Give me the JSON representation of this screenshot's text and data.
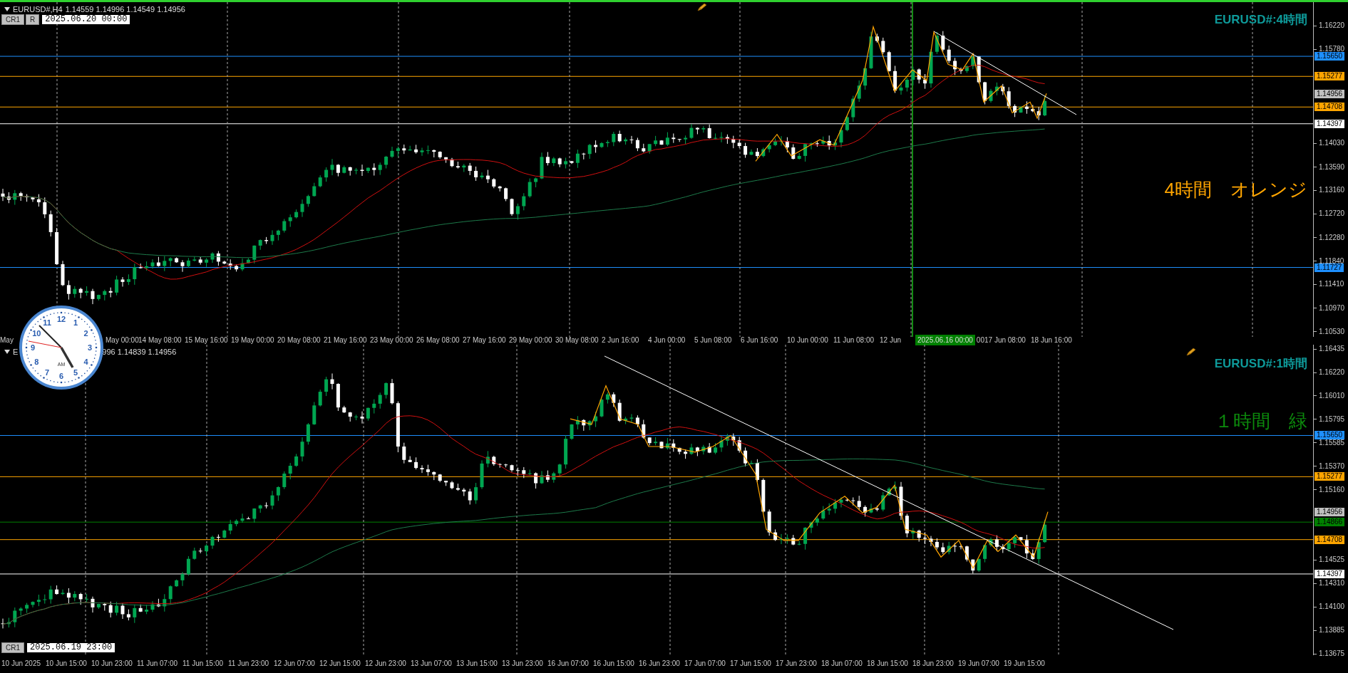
{
  "upper_chart": {
    "header": {
      "symbol": "EURUSD#,H4",
      "quote": "1.14559 1.14996 1.14549 1.14956"
    },
    "buttons": [
      "CR1",
      "R"
    ],
    "cursor_time": "2025.06.20 00:00",
    "title": "EURUSD#:4時間",
    "note": "4時間　オレンジ",
    "price_ticks": [
      "1.16220",
      "1.15780",
      "1.14030",
      "1.13590",
      "1.13160",
      "1.12720",
      "1.12280",
      "1.11840",
      "1.11410",
      "1.10970",
      "1.10530"
    ],
    "price_labels": [
      {
        "text": "1.15650",
        "kind": "level",
        "color": "#1e90ff"
      },
      {
        "text": "1.15277",
        "kind": "level",
        "color": "#ffa500"
      },
      {
        "text": "1.14956",
        "kind": "bid",
        "color": "#c0c0c0"
      },
      {
        "text": "1.14708",
        "kind": "level",
        "color": "#ffa500"
      },
      {
        "text": "1.14397",
        "kind": "level",
        "color": "#ffffff"
      },
      {
        "text": "1.11727",
        "kind": "level",
        "color": "#1e90ff"
      }
    ],
    "time_ticks": [
      {
        "text": "May",
        "kind": "tick"
      },
      {
        "text": "May 00:00",
        "kind": "tick"
      },
      {
        "text": "14 May 08:00",
        "kind": "tick"
      },
      {
        "text": "15 May 16:00",
        "kind": "tick"
      },
      {
        "text": "19 May 00:00",
        "kind": "tick"
      },
      {
        "text": "20 May 08:00",
        "kind": "tick"
      },
      {
        "text": "21 May 16:00",
        "kind": "tick"
      },
      {
        "text": "23 May 00:00",
        "kind": "tick"
      },
      {
        "text": "26 May 08:00",
        "kind": "tick"
      },
      {
        "text": "27 May 16:00",
        "kind": "tick"
      },
      {
        "text": "29 May 00:00",
        "kind": "tick"
      },
      {
        "text": "30 May 08:00",
        "kind": "tick"
      },
      {
        "text": "2 Jun 16:00",
        "kind": "tick"
      },
      {
        "text": "4 Jun 00:00",
        "kind": "tick"
      },
      {
        "text": "5 Jun 08:00",
        "kind": "tick"
      },
      {
        "text": "6 Jun 16:00",
        "kind": "tick"
      },
      {
        "text": "10 Jun 00:00",
        "kind": "tick"
      },
      {
        "text": "11 Jun 08:00",
        "kind": "tick"
      },
      {
        "text": "12 Jun",
        "kind": "tick"
      },
      {
        "text": "2025.06.16 00:00",
        "kind": "marker"
      },
      {
        "text": "00",
        "kind": "tick"
      },
      {
        "text": "17 Jun 08:00",
        "kind": "tick"
      },
      {
        "text": "18 Jun 16:00",
        "kind": "tick"
      }
    ]
  },
  "lower_chart": {
    "header": {
      "symbol": "E",
      "quote": "996 1.14839 1.14956"
    },
    "buttons": [
      "CR1"
    ],
    "cursor_time": "2025.06.19 23:00",
    "title": "EURUSD#:1時間",
    "note": "１時間　緑",
    "price_ticks": [
      "1.16435",
      "1.16220",
      "1.16010",
      "1.15795",
      "1.15585",
      "1.15370",
      "1.15160",
      "1.14525",
      "1.14310",
      "1.14100",
      "1.13885",
      "1.13675"
    ],
    "price_labels": [
      {
        "text": "1.15650",
        "kind": "level",
        "color": "#1e90ff"
      },
      {
        "text": "1.15277",
        "kind": "level",
        "color": "#ffa500"
      },
      {
        "text": "1.14956",
        "kind": "bid",
        "color": "#c0c0c0"
      },
      {
        "text": "1.14866",
        "kind": "level",
        "color": "#008000"
      },
      {
        "text": "1.14708",
        "kind": "level",
        "color": "#ffa500"
      },
      {
        "text": "1.14397",
        "kind": "level",
        "color": "#ffffff"
      }
    ],
    "time_ticks": [
      {
        "text": "10 Jun 2025",
        "kind": "tick"
      },
      {
        "text": "10 Jun 15:00",
        "kind": "tick"
      },
      {
        "text": "10 Jun 23:00",
        "kind": "tick"
      },
      {
        "text": "11 Jun 07:00",
        "kind": "tick"
      },
      {
        "text": "11 Jun 15:00",
        "kind": "tick"
      },
      {
        "text": "11 Jun 23:00",
        "kind": "tick"
      },
      {
        "text": "12 Jun 07:00",
        "kind": "tick"
      },
      {
        "text": "12 Jun 15:00",
        "kind": "tick"
      },
      {
        "text": "12 Jun 23:00",
        "kind": "tick"
      },
      {
        "text": "13 Jun 07:00",
        "kind": "tick"
      },
      {
        "text": "13 Jun 15:00",
        "kind": "tick"
      },
      {
        "text": "13 Jun 23:00",
        "kind": "tick"
      },
      {
        "text": "16 Jun 07:00",
        "kind": "tick"
      },
      {
        "text": "16 Jun 15:00",
        "kind": "tick"
      },
      {
        "text": "16 Jun 23:00",
        "kind": "tick"
      },
      {
        "text": "17 Jun 07:00",
        "kind": "tick"
      },
      {
        "text": "17 Jun 15:00",
        "kind": "tick"
      },
      {
        "text": "17 Jun 23:00",
        "kind": "tick"
      },
      {
        "text": "18 Jun 07:00",
        "kind": "tick"
      },
      {
        "text": "18 Jun 15:00",
        "kind": "tick"
      },
      {
        "text": "18 Jun 23:00",
        "kind": "tick"
      },
      {
        "text": "19 Jun 07:00",
        "kind": "tick"
      },
      {
        "text": "19 Jun 15:00",
        "kind": "tick"
      }
    ]
  },
  "clock": {
    "numerals": [
      "12",
      "1",
      "2",
      "3",
      "4",
      "5",
      "6",
      "7",
      "8",
      "9",
      "10",
      "11"
    ],
    "period": "AM"
  }
}
